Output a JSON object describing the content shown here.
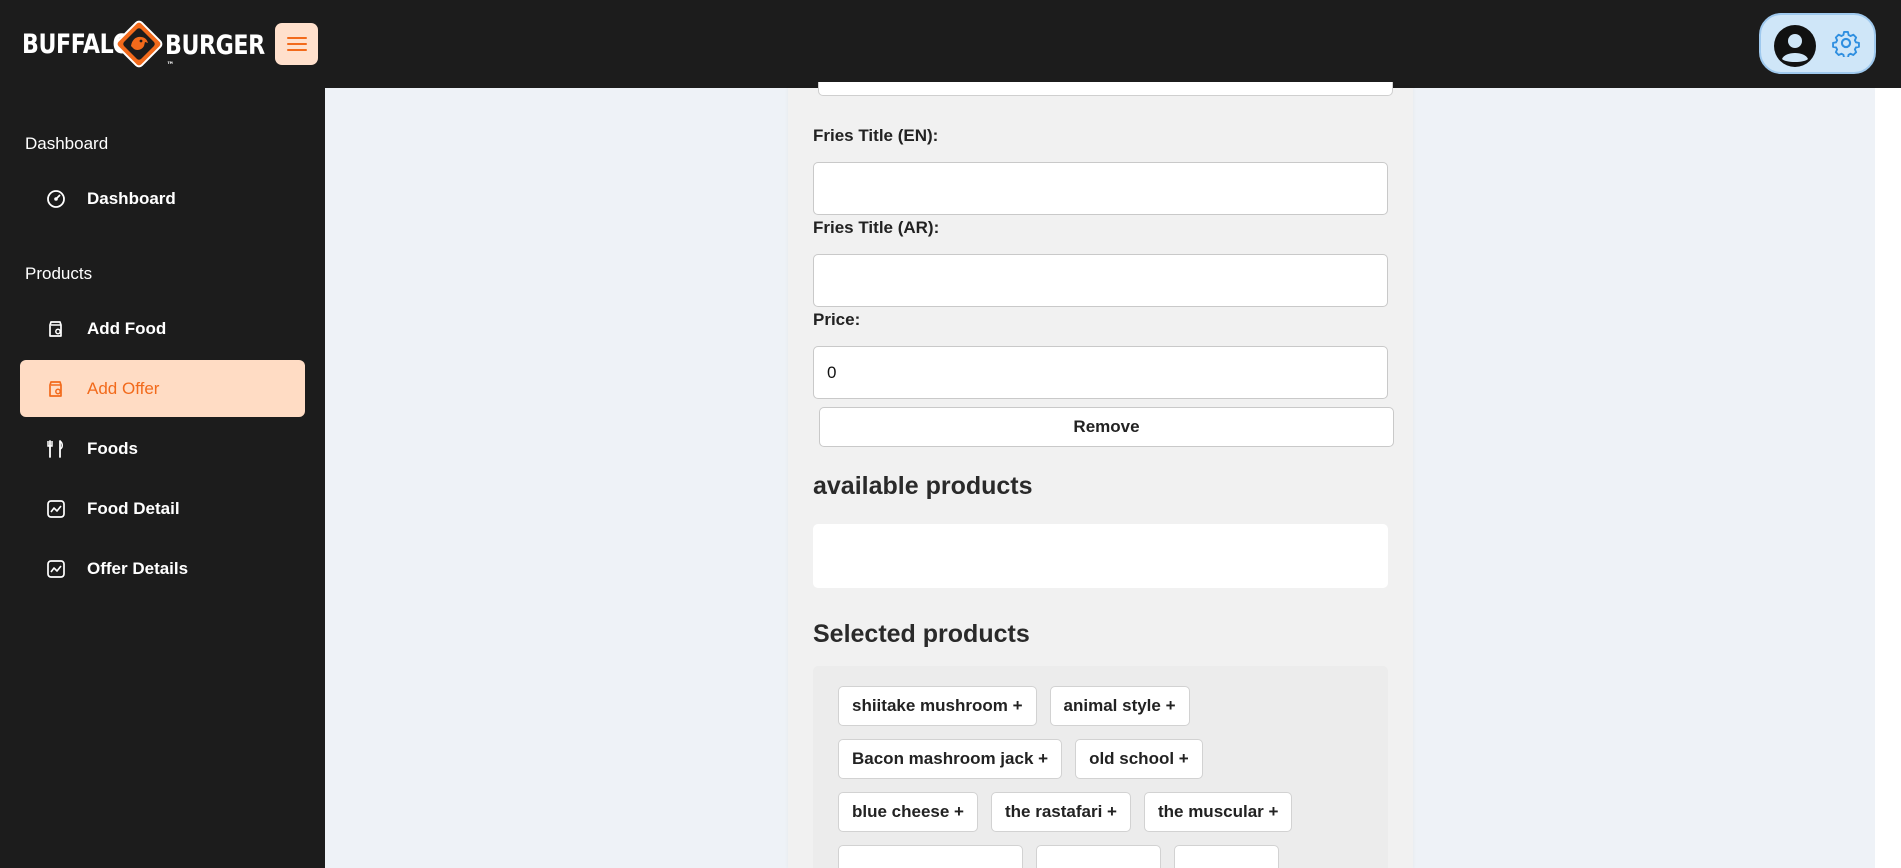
{
  "brand": {
    "name_left": "BUFFALO",
    "name_right": "BURGER",
    "trademark": "™",
    "accent": "#f26a1b",
    "mark_color": "#f26a1b"
  },
  "header": {
    "menu_icon": "hamburger-menu-icon",
    "avatar_icon": "user-avatar-icon",
    "settings_icon": "gear-icon"
  },
  "sidebar": {
    "sections": [
      {
        "title": "Dashboard"
      },
      {
        "title": "Products"
      }
    ],
    "items": [
      {
        "label": "Dashboard",
        "icon": "gauge-icon",
        "active": false
      },
      {
        "label": "Add Food",
        "icon": "food-bag-icon",
        "active": false
      },
      {
        "label": "Add Offer",
        "icon": "food-bag-icon",
        "active": true
      },
      {
        "label": "Foods",
        "icon": "utensils-icon",
        "active": false
      },
      {
        "label": "Food Detail",
        "icon": "chart-line-icon",
        "active": false
      },
      {
        "label": "Offer Details",
        "icon": "chart-line-icon",
        "active": false
      }
    ]
  },
  "form": {
    "fries_title_en_label": "Fries Title (EN):",
    "fries_title_en_value": "",
    "fries_title_ar_label": "Fries Title (AR):",
    "fries_title_ar_value": "",
    "price_label": "Price:",
    "price_value": "0",
    "remove_label": "Remove",
    "available_heading": "available products",
    "selected_heading": "Selected products"
  },
  "selected_products": [
    [
      "shiitake mushroom +",
      "animal style +"
    ],
    [
      "Bacon mashroom jack +",
      "old school +"
    ],
    [
      "blue cheese +",
      "the rastafari +",
      "the muscular +"
    ]
  ]
}
